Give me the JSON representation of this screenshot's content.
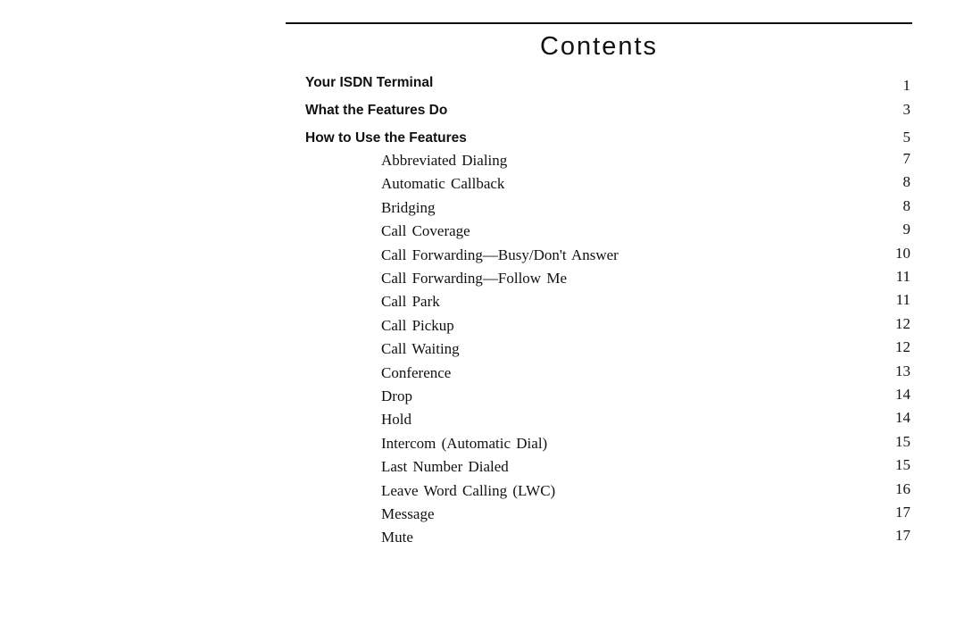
{
  "heading": "Contents",
  "sections": [
    {
      "label": "Your ISDN Terminal",
      "page": "1"
    },
    {
      "label": "What the Features Do",
      "page": "3"
    },
    {
      "label": "How to Use the Features",
      "page": "5"
    }
  ],
  "features": [
    {
      "label": "Abbreviated Dialing",
      "page": "7"
    },
    {
      "label": "Automatic Callback",
      "page": "8"
    },
    {
      "label": "Bridging",
      "page": "8"
    },
    {
      "label": "Call Coverage",
      "page": "9"
    },
    {
      "label": "Call Forwarding—Busy/Don't Answer",
      "page": "10"
    },
    {
      "label": "Call Forwarding—Follow Me",
      "page": "11"
    },
    {
      "label": "Call Park",
      "page": "11"
    },
    {
      "label": "Call Pickup",
      "page": "12"
    },
    {
      "label": "Call Waiting",
      "page": "12"
    },
    {
      "label": "Conference",
      "page": "13"
    },
    {
      "label": "Drop",
      "page": "14"
    },
    {
      "label": "Hold",
      "page": "14"
    },
    {
      "label": "Intercom (Automatic Dial)",
      "page": "15"
    },
    {
      "label": "Last Number Dialed",
      "page": "15"
    },
    {
      "label": "Leave Word Calling (LWC)",
      "page": "16"
    },
    {
      "label": "Message",
      "page": "17"
    },
    {
      "label": "Mute",
      "page": "17"
    }
  ]
}
